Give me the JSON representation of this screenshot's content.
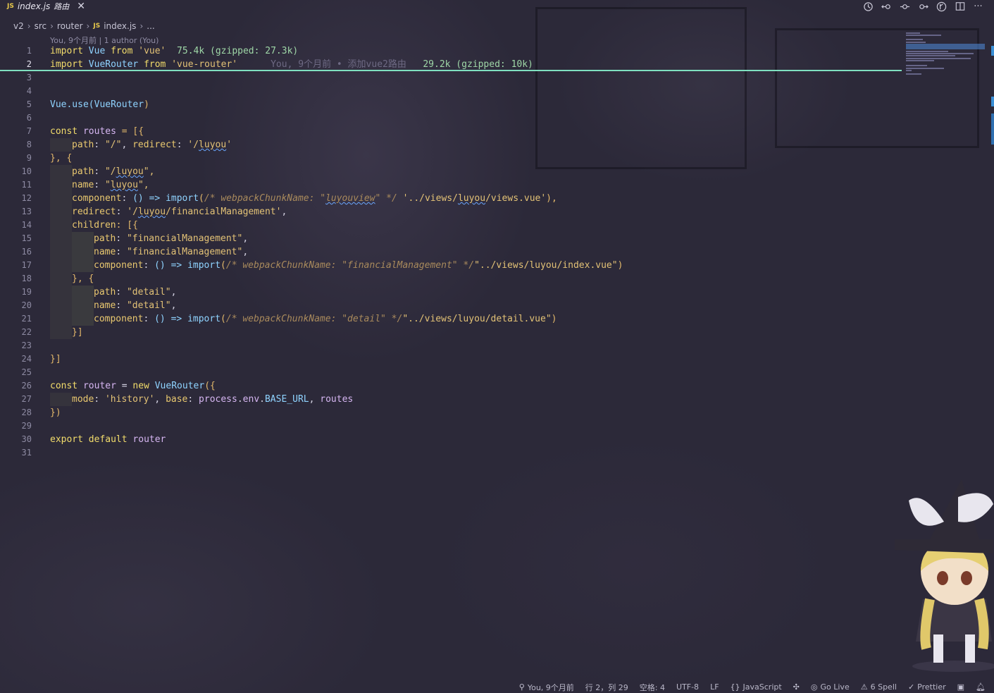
{
  "tab": {
    "lang_badge": "JS",
    "filename": "index.js",
    "description": "路由",
    "close_glyph": "✕"
  },
  "toolbar": {
    "icons": [
      "history-icon",
      "go-back-icon",
      "commit-icon",
      "go-forward-icon",
      "git-graph-icon",
      "split-editor-icon",
      "more-actions-icon"
    ]
  },
  "breadcrumb": {
    "items": [
      "v2",
      "src",
      "router",
      "index.js",
      "..."
    ],
    "file_badge": "JS"
  },
  "blame": {
    "header": "You, 9个月前 | 1 author (You)",
    "line2_ghost": "You, 9个月前 • 添加vue2路由"
  },
  "import_costs": {
    "vue": "75.4k (gzipped: 27.3k)",
    "vue_router": "29.2k (gzipped: 10k)"
  },
  "code": {
    "l1": [
      "import",
      "Vue",
      "from",
      "'vue'"
    ],
    "l2": [
      "import",
      "VueRouter",
      "from",
      "'vue-router'"
    ],
    "l5": [
      "Vue",
      ".use(",
      "VueRouter",
      ")"
    ],
    "l7": [
      "const",
      "routes",
      "= [{"
    ],
    "l8": [
      "path",
      ": ",
      "\"/\"",
      ", ",
      "redirect",
      ": ",
      "'/",
      "luyou",
      "'"
    ],
    "l9": "}, {",
    "l10": [
      "path",
      ": ",
      "\"/",
      "luyou",
      "\","
    ],
    "l11": [
      "name",
      ": ",
      "\"",
      "luyou",
      "\","
    ],
    "l12": [
      "component",
      ": ",
      "() => ",
      "import",
      "(",
      "/* webpackChunkName: ",
      "\"",
      "luyouview",
      "\" */",
      " '../views/",
      "luyou",
      "/views.vue'",
      "),"
    ],
    "l13": [
      "redirect",
      ": ",
      "'/",
      "luyou",
      "/financialManagement'",
      ","
    ],
    "l14": [
      "children",
      ": [{"
    ],
    "l15": [
      "path",
      ": ",
      "\"financialManagement\"",
      ","
    ],
    "l16": [
      "name",
      ": ",
      "\"financialManagement\"",
      ","
    ],
    "l17": [
      "component",
      ": ",
      "() => ",
      "import",
      "(",
      "/* webpackChunkName: \"financialManagement\" */",
      "\"../views/luyou/index.vue\"",
      ")"
    ],
    "l18": "}, {",
    "l19": [
      "path",
      ": ",
      "\"detail\"",
      ","
    ],
    "l20": [
      "name",
      ": ",
      "\"detail\"",
      ","
    ],
    "l21": [
      "component",
      ": ",
      "() => ",
      "import",
      "(",
      "/* webpackChunkName: \"detail\" */",
      "\"../views/luyou/detail.vue\"",
      ")"
    ],
    "l22": "}]",
    "l24": "}]",
    "l26": [
      "const",
      "router",
      "=",
      "new",
      "VueRouter",
      "({"
    ],
    "l27": [
      "mode",
      ": ",
      "'history'",
      ", ",
      "base",
      ": ",
      "process",
      ".",
      "env",
      ".",
      "BASE_URL",
      ", ",
      "routes"
    ],
    "l28": "})",
    "l30": [
      "export",
      "default",
      "router"
    ]
  },
  "line_numbers": [
    "1",
    "2",
    "3",
    "4",
    "5",
    "6",
    "7",
    "8",
    "9",
    "10",
    "11",
    "12",
    "13",
    "14",
    "15",
    "16",
    "17",
    "18",
    "19",
    "20",
    "21",
    "22",
    "23",
    "24",
    "25",
    "26",
    "27",
    "28",
    "29",
    "30",
    "31"
  ],
  "status": {
    "blame": "You, 9个月前",
    "position": "行 2，列 29",
    "spaces": "空格: 4",
    "encoding": "UTF-8",
    "eol": "LF",
    "language": "JavaScript",
    "go_live": "Go Live",
    "spell": "6 Spell",
    "prettier": "Prettier"
  },
  "colors": {
    "background": "#2d2a3a",
    "current_line_underline": "#7fe0c0",
    "keyword": "#f2dc6b",
    "function": "#8fd3ff",
    "comment": "#a98a5c"
  }
}
